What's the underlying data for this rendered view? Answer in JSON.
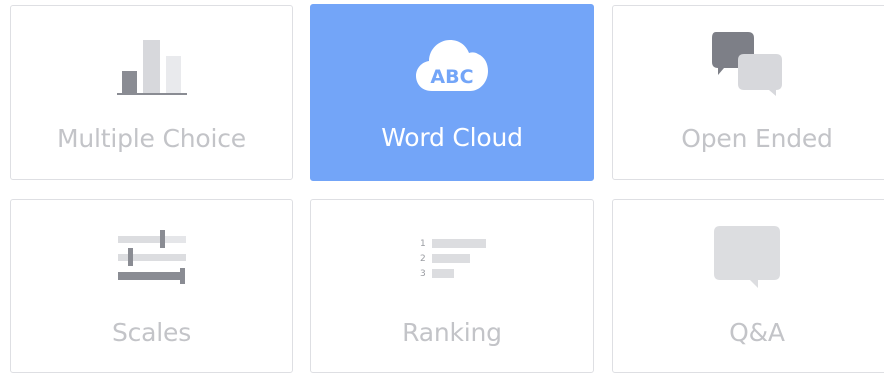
{
  "question_types": [
    {
      "label": "Multiple Choice",
      "icon": "bar-chart-icon",
      "selected": false
    },
    {
      "label": "Word Cloud",
      "icon": "cloud-abc-icon",
      "selected": true,
      "icon_text": "ABC"
    },
    {
      "label": "Open Ended",
      "icon": "speech-bubbles-icon",
      "selected": false
    },
    {
      "label": "Scales",
      "icon": "scales-sliders-icon",
      "selected": false
    },
    {
      "label": "Ranking",
      "icon": "ranking-list-icon",
      "selected": false,
      "ranks": [
        "1",
        "2",
        "3"
      ]
    },
    {
      "label": "Q&A",
      "icon": "qa-bubble-icon",
      "selected": false
    }
  ],
  "colors": {
    "selected_bg": "#73a5f8",
    "border": "#dedfe3",
    "label": "#c3c4c8",
    "icon_dark": "#8a8c93",
    "icon_light": "#dadbdf"
  }
}
